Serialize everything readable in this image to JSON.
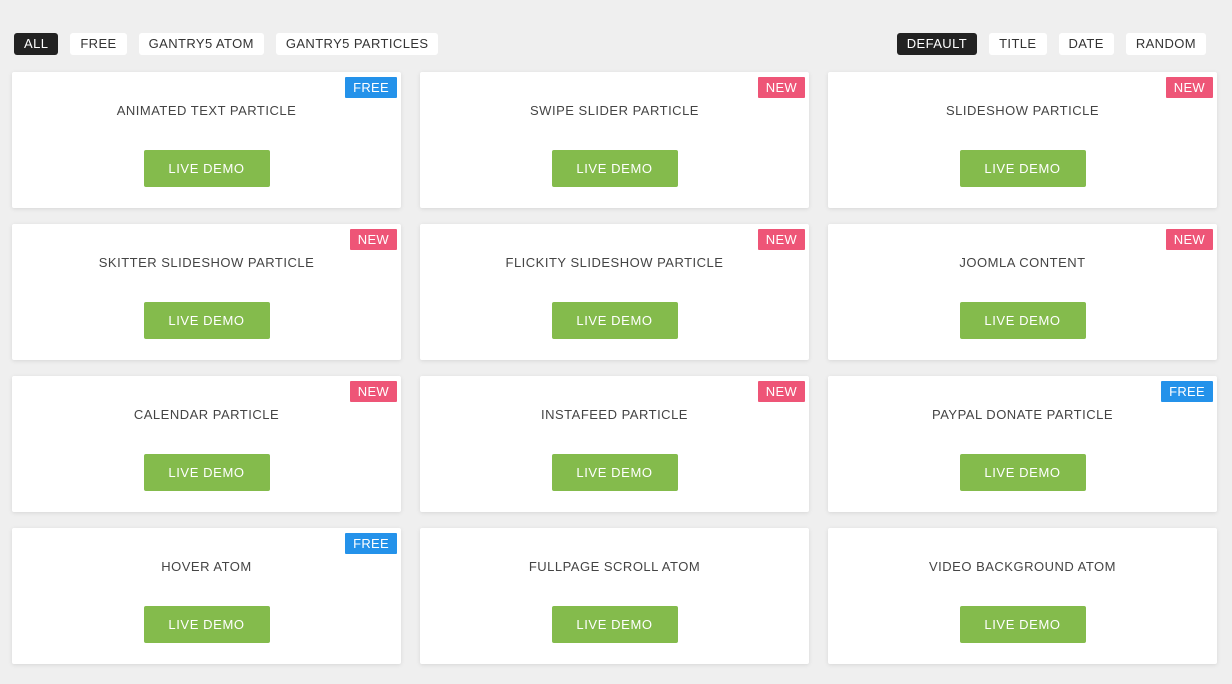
{
  "colors": {
    "page_background": "#efefef",
    "badge_free": "#2492ea",
    "badge_new": "#ee5577",
    "button_green": "#84bb4c",
    "filter_active_bg": "#222222"
  },
  "filters": {
    "categories": [
      {
        "label": "ALL",
        "active": true
      },
      {
        "label": "FREE",
        "active": false
      },
      {
        "label": "GANTRY5 ATOM",
        "active": false
      },
      {
        "label": "GANTRY5 PARTICLES",
        "active": false
      }
    ],
    "sort": [
      {
        "label": "DEFAULT",
        "active": true
      },
      {
        "label": "TITLE",
        "active": false
      },
      {
        "label": "DATE",
        "active": false
      },
      {
        "label": "RANDOM",
        "active": false
      }
    ]
  },
  "card_button_label": "LIVE DEMO",
  "cards": [
    {
      "title": "ANIMATED TEXT PARTICLE",
      "badge": "FREE"
    },
    {
      "title": "SWIPE SLIDER PARTICLE",
      "badge": "NEW"
    },
    {
      "title": "SLIDESHOW PARTICLE",
      "badge": "NEW"
    },
    {
      "title": "SKITTER SLIDESHOW PARTICLE",
      "badge": "NEW"
    },
    {
      "title": "FLICKITY SLIDESHOW PARTICLE",
      "badge": "NEW"
    },
    {
      "title": "JOOMLA CONTENT",
      "badge": "NEW"
    },
    {
      "title": "CALENDAR PARTICLE",
      "badge": "NEW"
    },
    {
      "title": "INSTAFEED PARTICLE",
      "badge": "NEW"
    },
    {
      "title": "PAYPAL DONATE PARTICLE",
      "badge": "FREE"
    },
    {
      "title": "HOVER ATOM",
      "badge": "FREE"
    },
    {
      "title": "FULLPAGE SCROLL ATOM",
      "badge": null
    },
    {
      "title": "VIDEO BACKGROUND ATOM",
      "badge": null
    }
  ]
}
